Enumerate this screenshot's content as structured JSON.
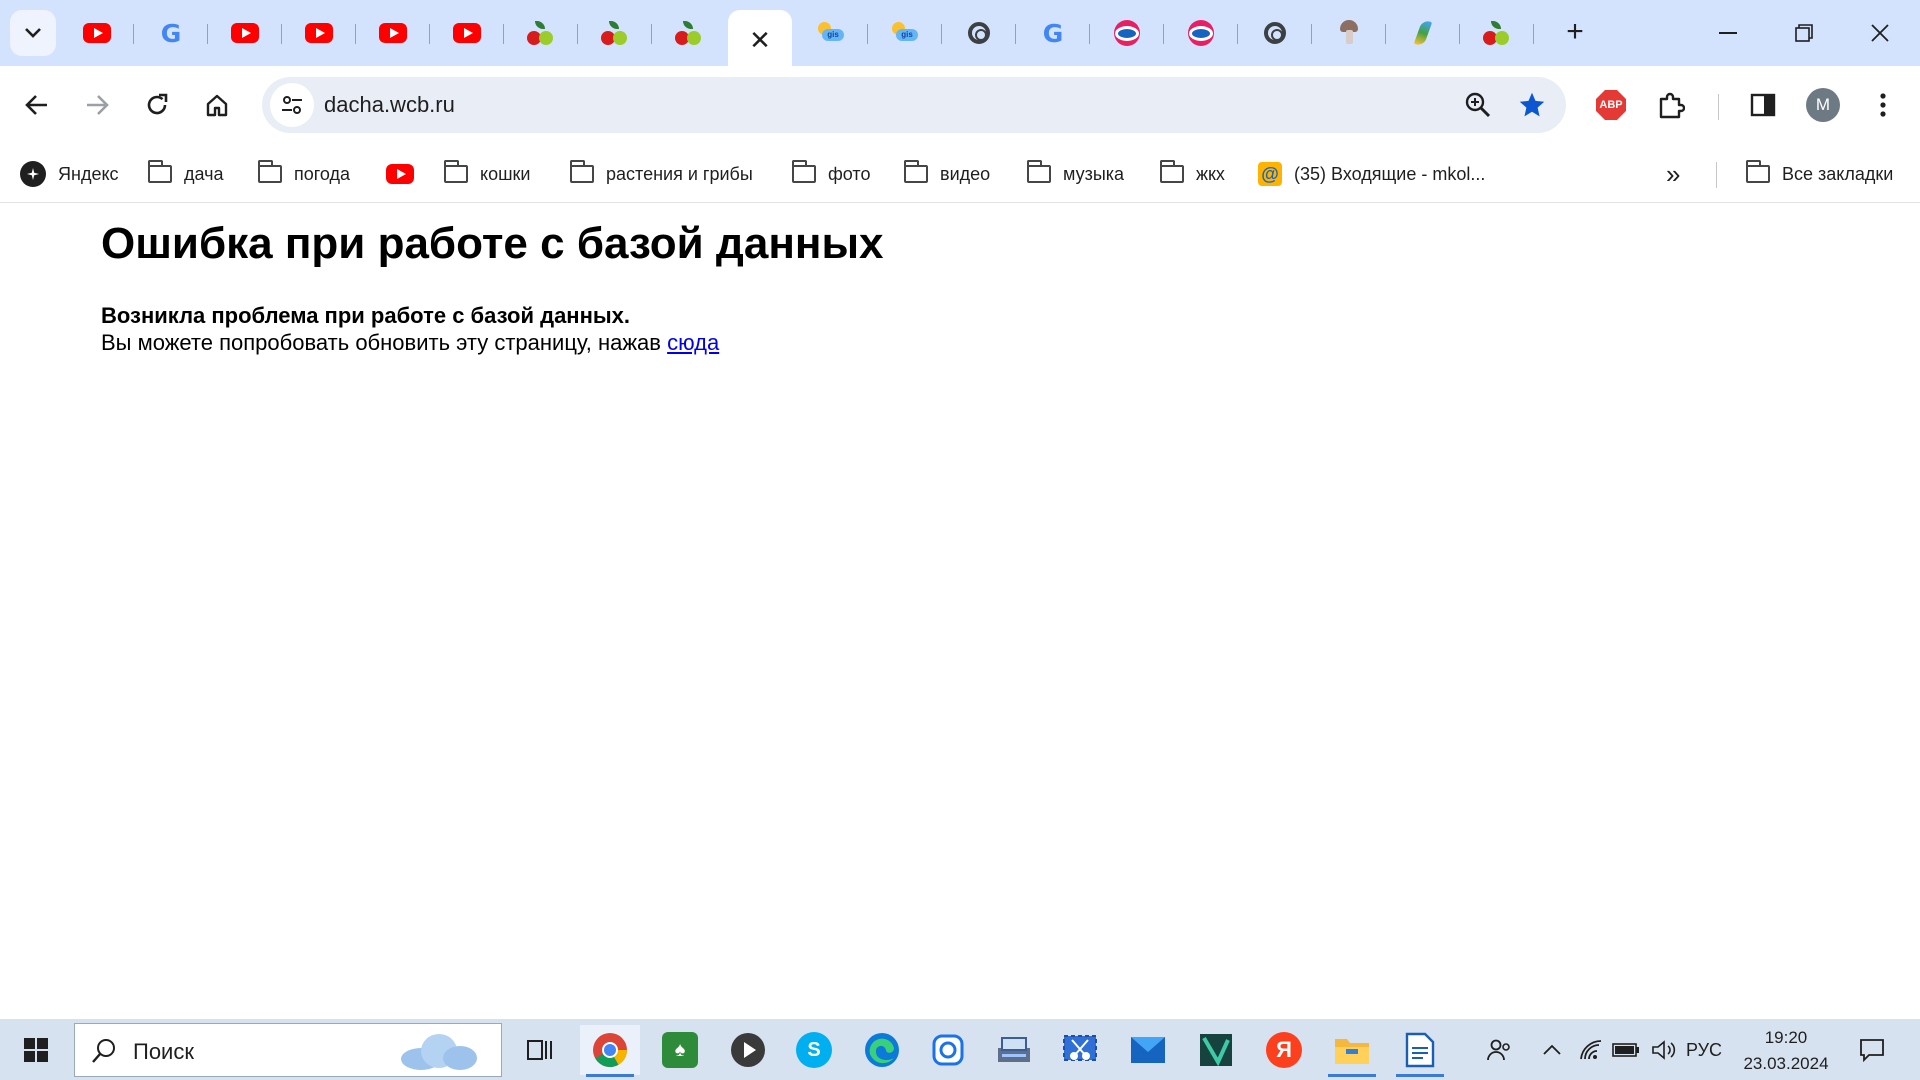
{
  "browser": {
    "tabs": [
      {
        "icon": "youtube-icon"
      },
      {
        "icon": "google-icon",
        "glyph": "G"
      },
      {
        "icon": "youtube-icon"
      },
      {
        "icon": "youtube-icon"
      },
      {
        "icon": "youtube-icon"
      },
      {
        "icon": "youtube-icon"
      },
      {
        "icon": "cherry-icon"
      },
      {
        "icon": "cherry-icon"
      },
      {
        "icon": "cherry-icon"
      },
      {
        "icon": "close-icon",
        "active": true,
        "glyph": "✕"
      },
      {
        "icon": "weather-icon",
        "badge": "gis"
      },
      {
        "icon": "weather-icon",
        "badge": "gis"
      },
      {
        "icon": "chrome-icon"
      },
      {
        "icon": "google-icon",
        "glyph": "G"
      },
      {
        "icon": "odnoklassniki-icon"
      },
      {
        "icon": "odnoklassniki-icon"
      },
      {
        "icon": "chrome-icon"
      },
      {
        "icon": "mushroom-icon"
      },
      {
        "icon": "feather-icon"
      },
      {
        "icon": "cherry-icon"
      }
    ],
    "new_tab_glyph": "+",
    "address": {
      "url": "dacha.wcb.ru"
    },
    "bookmarks": [
      {
        "label": "Яндекс",
        "icon": "yandex-icon"
      },
      {
        "label": "дача",
        "icon": "folder-icon"
      },
      {
        "label": "погода",
        "icon": "folder-icon"
      },
      {
        "label": "",
        "icon": "youtube-icon"
      },
      {
        "label": "кошки",
        "icon": "folder-icon"
      },
      {
        "label": "растения и грибы",
        "icon": "folder-icon"
      },
      {
        "label": "фото",
        "icon": "folder-icon"
      },
      {
        "label": "видео",
        "icon": "folder-icon"
      },
      {
        "label": "музыка",
        "icon": "folder-icon"
      },
      {
        "label": "жкх",
        "icon": "folder-icon"
      },
      {
        "label": "(35) Входящие - mkol...",
        "icon": "mail-icon"
      }
    ],
    "bookmarks_overflow_glyph": "»",
    "all_bookmarks_label": "Все закладки",
    "profile_initial": "M",
    "abp_label": "ABP"
  },
  "page": {
    "title": "Ошибка при работе с базой данных",
    "strong_message": "Возникла проблема при работе с базой данных.",
    "message": "Вы можете попробовать обновить эту страницу, нажав ",
    "link_text": "сюда"
  },
  "taskbar": {
    "search_placeholder": "Поиск",
    "language": "РУС",
    "time": "19:20",
    "date": "23.03.2024",
    "yandex_glyph": "Я",
    "skype_glyph": "S"
  },
  "colors": {
    "tabstrip_bg": "#d3e3fd",
    "omnibox_bg": "#e9eef6",
    "star_blue": "#0b57d0",
    "link": "#0000ee",
    "taskbar_bg": "#d7e2f0"
  }
}
